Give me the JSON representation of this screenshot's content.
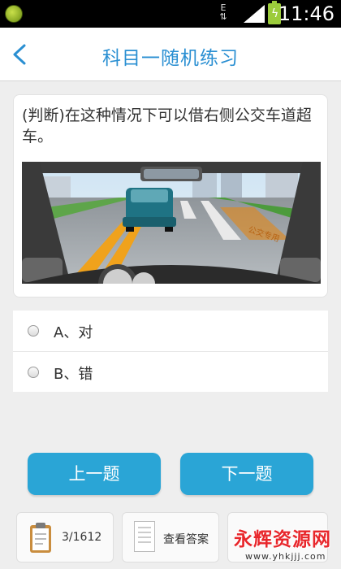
{
  "status_bar": {
    "network_label": "E",
    "time": "11:46"
  },
  "header": {
    "title": "科目一随机练习"
  },
  "question": {
    "text": "(判断)在这种情况下可以借右侧公交车道超车。",
    "scene_road_marking": "公交专用"
  },
  "options": [
    {
      "label": "A、对"
    },
    {
      "label": "B、错"
    }
  ],
  "buttons": {
    "prev": "上一题",
    "next": "下一题"
  },
  "toolbar": {
    "progress": "3/1612",
    "answer_label": "查看答案"
  },
  "watermark": {
    "main": "永辉资源网",
    "sub": "www.yhkjjj.com"
  },
  "colors": {
    "accent": "#2a8fd2",
    "button": "#2aa5d6",
    "watermark": "#e8262b"
  }
}
